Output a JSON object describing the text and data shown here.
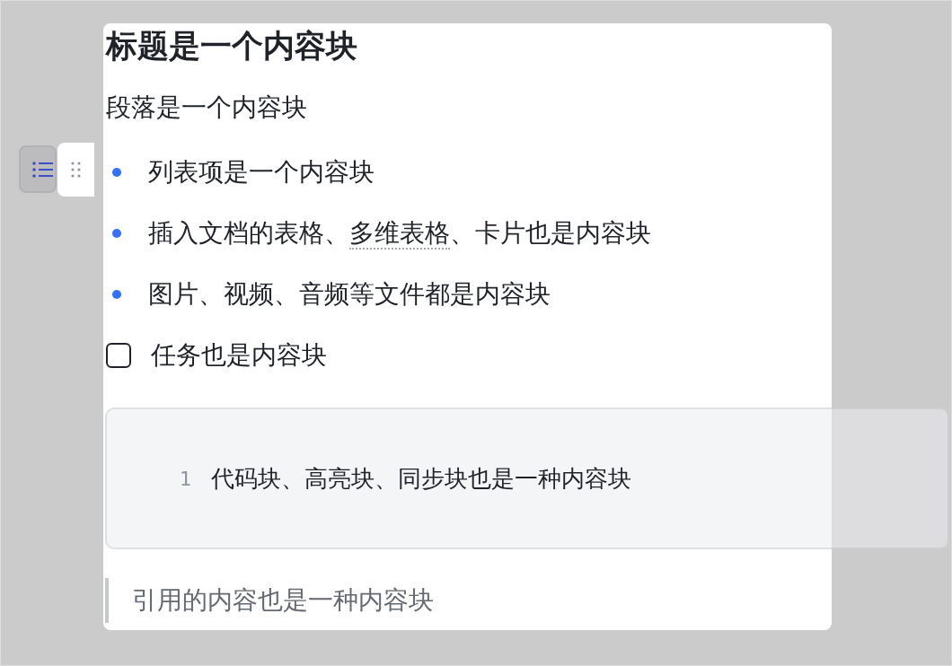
{
  "blocks": [
    {
      "kind": "heading",
      "text": "标题是一个内容块"
    },
    {
      "kind": "paragraph",
      "text": "段落是一个内容块"
    },
    {
      "kind": "bullet",
      "hovered": true,
      "parts": [
        {
          "text": "列表项是一个内容块"
        }
      ]
    },
    {
      "kind": "bullet",
      "hovered": false,
      "parts": [
        {
          "text": "插入文档的表格、"
        },
        {
          "text": "多维表格",
          "kind": "mention"
        },
        {
          "text": "、卡片也是内容块"
        }
      ]
    },
    {
      "kind": "bullet",
      "hovered": false,
      "parts": [
        {
          "text": "图片、视频、音频等文件都是内容块"
        }
      ]
    },
    {
      "kind": "task",
      "checked": false,
      "text": "任务也是内容块"
    },
    {
      "kind": "code",
      "lines": [
        {
          "number": "1",
          "text": "代码块、高亮块、同步块也是一种内容块"
        }
      ]
    },
    {
      "kind": "quote",
      "text": "引用的内容也是一种内容块"
    }
  ]
}
